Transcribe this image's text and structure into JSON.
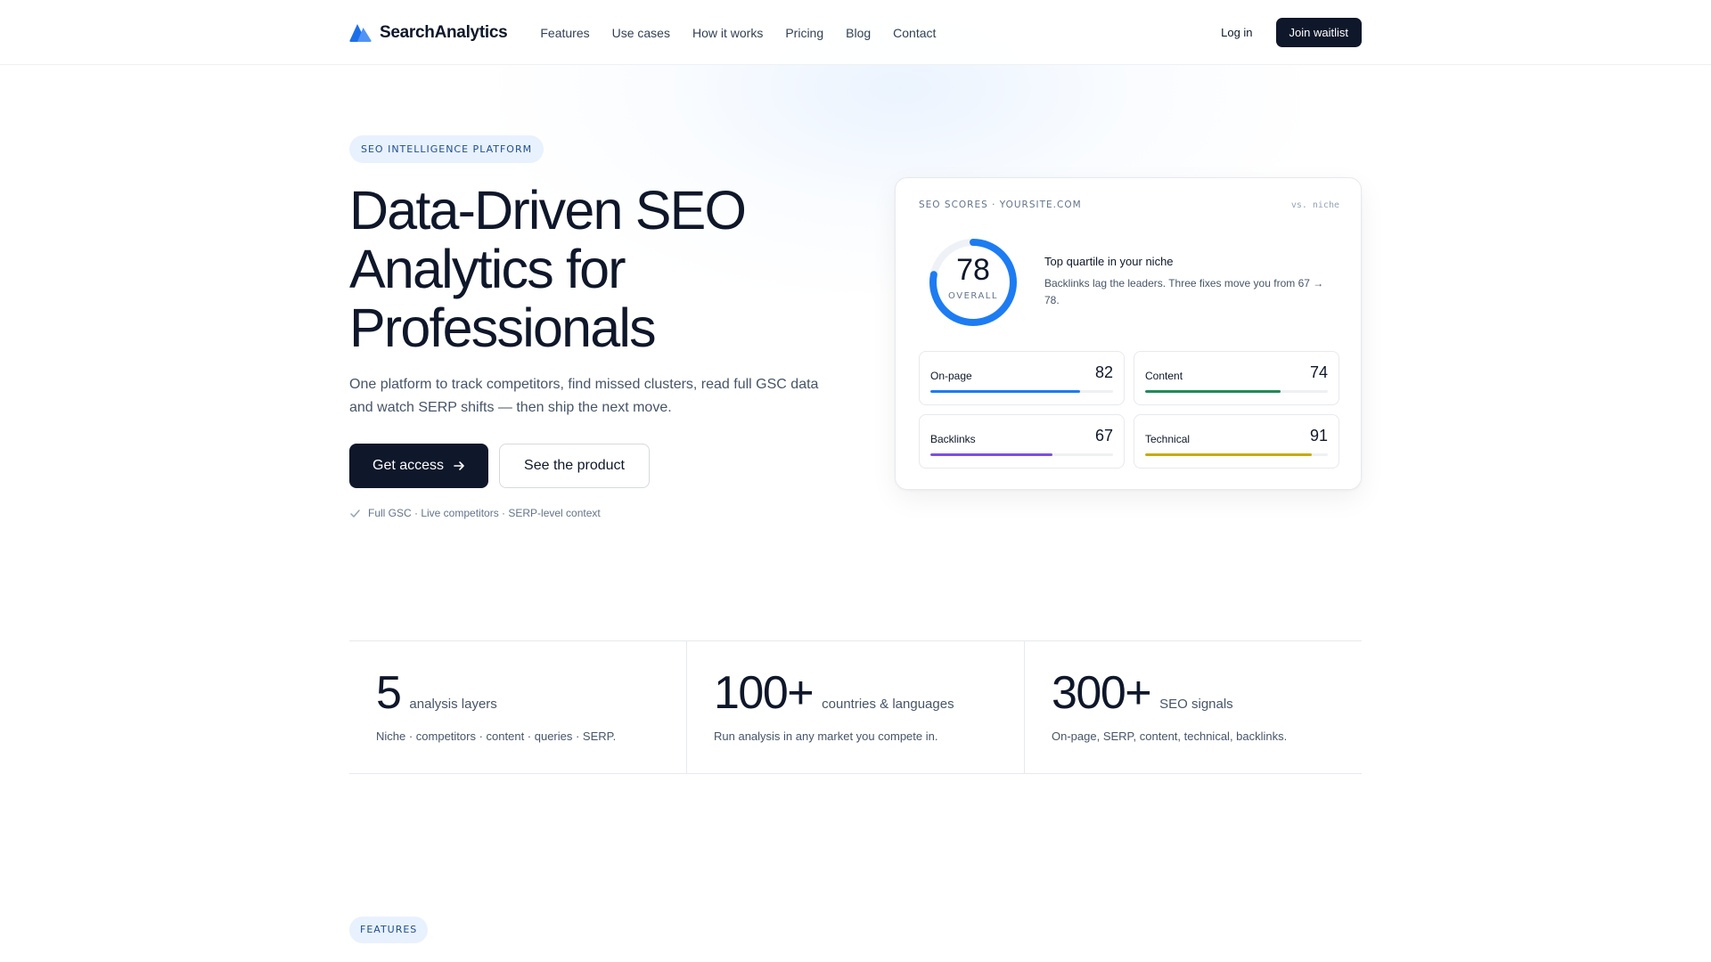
{
  "brand": {
    "name": "SearchAnalytics",
    "logo_icon": "mountain-logo-icon",
    "colors": {
      "primary": "#0f172a",
      "accent": "#1d6fe8"
    }
  },
  "nav": {
    "links": [
      "Features",
      "Use cases",
      "How it works",
      "Pricing",
      "Blog",
      "Contact"
    ],
    "login_label": "Log in",
    "cta_label": "Join waitlist"
  },
  "hero": {
    "eyebrow": "SEO INTELLIGENCE PLATFORM",
    "title_lines": [
      "Data-Driven SEO",
      "Analytics for",
      "Professionals"
    ],
    "subtitle": "One platform to track competitors, find missed clusters, read full GSC data and watch SERP shifts — then ship the next move.",
    "primary_cta": "Get access",
    "primary_cta_icon": "arrow-right-icon",
    "secondary_cta": "See the product",
    "check_text": "Full GSC · Live competitors · SERP-level context"
  },
  "score_card": {
    "label": "SEO SCORES · YOURSITE.COM",
    "compare": "vs. niche",
    "overall": {
      "value": 78,
      "caption": "OVERALL",
      "max": 100,
      "color": "#1d7cf2"
    },
    "insight_title": "Top quartile in your niche",
    "insight_body": "Backlinks lag the leaders. Three fixes move you from 67 → 78.",
    "metrics": [
      {
        "label": "On-page",
        "value": 82,
        "color": "#1d7cf2"
      },
      {
        "label": "Content",
        "value": 74,
        "color": "#1f8a5b"
      },
      {
        "label": "Backlinks",
        "value": 67,
        "color": "#7c4ee4"
      },
      {
        "label": "Technical",
        "value": 91,
        "color": "#c9a90a"
      }
    ]
  },
  "stats": [
    {
      "number": "5",
      "unit": "analysis layers",
      "desc": "Niche · competitors · content · queries · SERP."
    },
    {
      "number": "100+",
      "unit": "countries & languages",
      "desc": "Run analysis in any market you compete in."
    },
    {
      "number": "300+",
      "unit": "SEO signals",
      "desc": "On-page, SERP, content, technical, backlinks."
    }
  ],
  "features_tag": "FEATURES"
}
